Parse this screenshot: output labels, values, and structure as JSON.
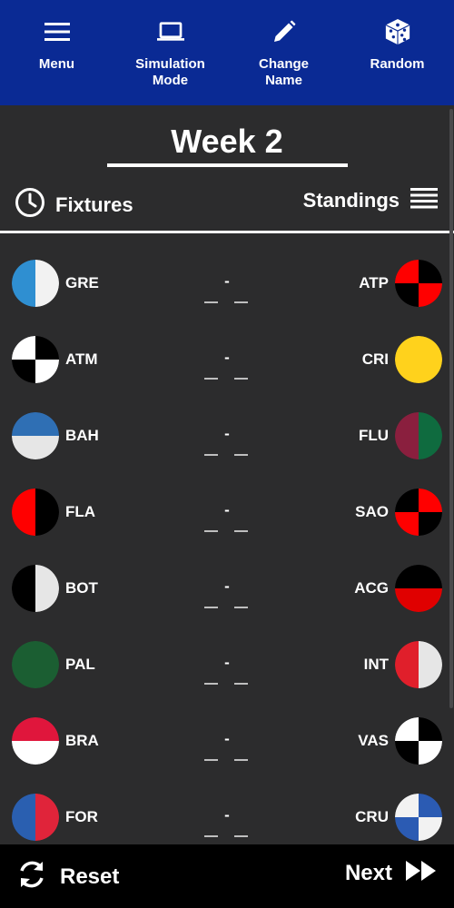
{
  "toolbar": {
    "items": [
      {
        "label": "Menu",
        "icon": "menu-icon"
      },
      {
        "label": "Simulation\nMode",
        "icon": "laptop-icon"
      },
      {
        "label": "Change\nName",
        "icon": "pencil-icon"
      },
      {
        "label": "Random",
        "icon": "dice-icon"
      }
    ],
    "background": "#0a2a94"
  },
  "week": {
    "title": "Week 2"
  },
  "tabs": {
    "fixtures_label": "Fixtures",
    "standings_label": "Standings"
  },
  "matches": [
    {
      "home": {
        "abbr": "GRE",
        "crest": "split-v",
        "colors": [
          "#2f8fd1",
          "#f2f2f2"
        ]
      },
      "away": {
        "abbr": "ATP",
        "crest": "quarters",
        "colors": [
          "#ff0000",
          "#000000"
        ]
      },
      "score": "-"
    },
    {
      "home": {
        "abbr": "ATM",
        "crest": "quarters",
        "colors": [
          "#ffffff",
          "#000000"
        ]
      },
      "away": {
        "abbr": "CRI",
        "crest": "solid",
        "colors": [
          "#ffd21c"
        ]
      },
      "score": "-"
    },
    {
      "home": {
        "abbr": "BAH",
        "crest": "split-h",
        "colors": [
          "#2f6fb4",
          "#e6e6e6"
        ]
      },
      "away": {
        "abbr": "FLU",
        "crest": "split-v",
        "colors": [
          "#8a1f3e",
          "#0f6b3f"
        ]
      },
      "score": "-"
    },
    {
      "home": {
        "abbr": "FLA",
        "crest": "split-v",
        "colors": [
          "#ff0000",
          "#000000"
        ]
      },
      "away": {
        "abbr": "SAO",
        "crest": "quarters",
        "colors": [
          "#000000",
          "#ff0000"
        ]
      },
      "score": "-"
    },
    {
      "home": {
        "abbr": "BOT",
        "crest": "split-v",
        "colors": [
          "#000000",
          "#e6e6e6"
        ]
      },
      "away": {
        "abbr": "ACG",
        "crest": "split-h",
        "colors": [
          "#000000",
          "#e00000"
        ]
      },
      "score": "-"
    },
    {
      "home": {
        "abbr": "PAL",
        "crest": "solid",
        "colors": [
          "#1b5e32"
        ]
      },
      "away": {
        "abbr": "INT",
        "crest": "split-v",
        "colors": [
          "#e01f2b",
          "#e6e6e6"
        ]
      },
      "score": "-"
    },
    {
      "home": {
        "abbr": "BRA",
        "crest": "split-h",
        "colors": [
          "#e0163c",
          "#ffffff"
        ]
      },
      "away": {
        "abbr": "VAS",
        "crest": "quarters",
        "colors": [
          "#ffffff",
          "#000000"
        ]
      },
      "score": "-"
    },
    {
      "home": {
        "abbr": "FOR",
        "crest": "split-v",
        "colors": [
          "#2a5fb0",
          "#e0243a"
        ]
      },
      "away": {
        "abbr": "CRU",
        "crest": "quarters",
        "colors": [
          "#f2f2f2",
          "#2b5bb3"
        ]
      },
      "score": "-"
    }
  ],
  "bottom": {
    "reset_label": "Reset",
    "next_label": "Next"
  }
}
